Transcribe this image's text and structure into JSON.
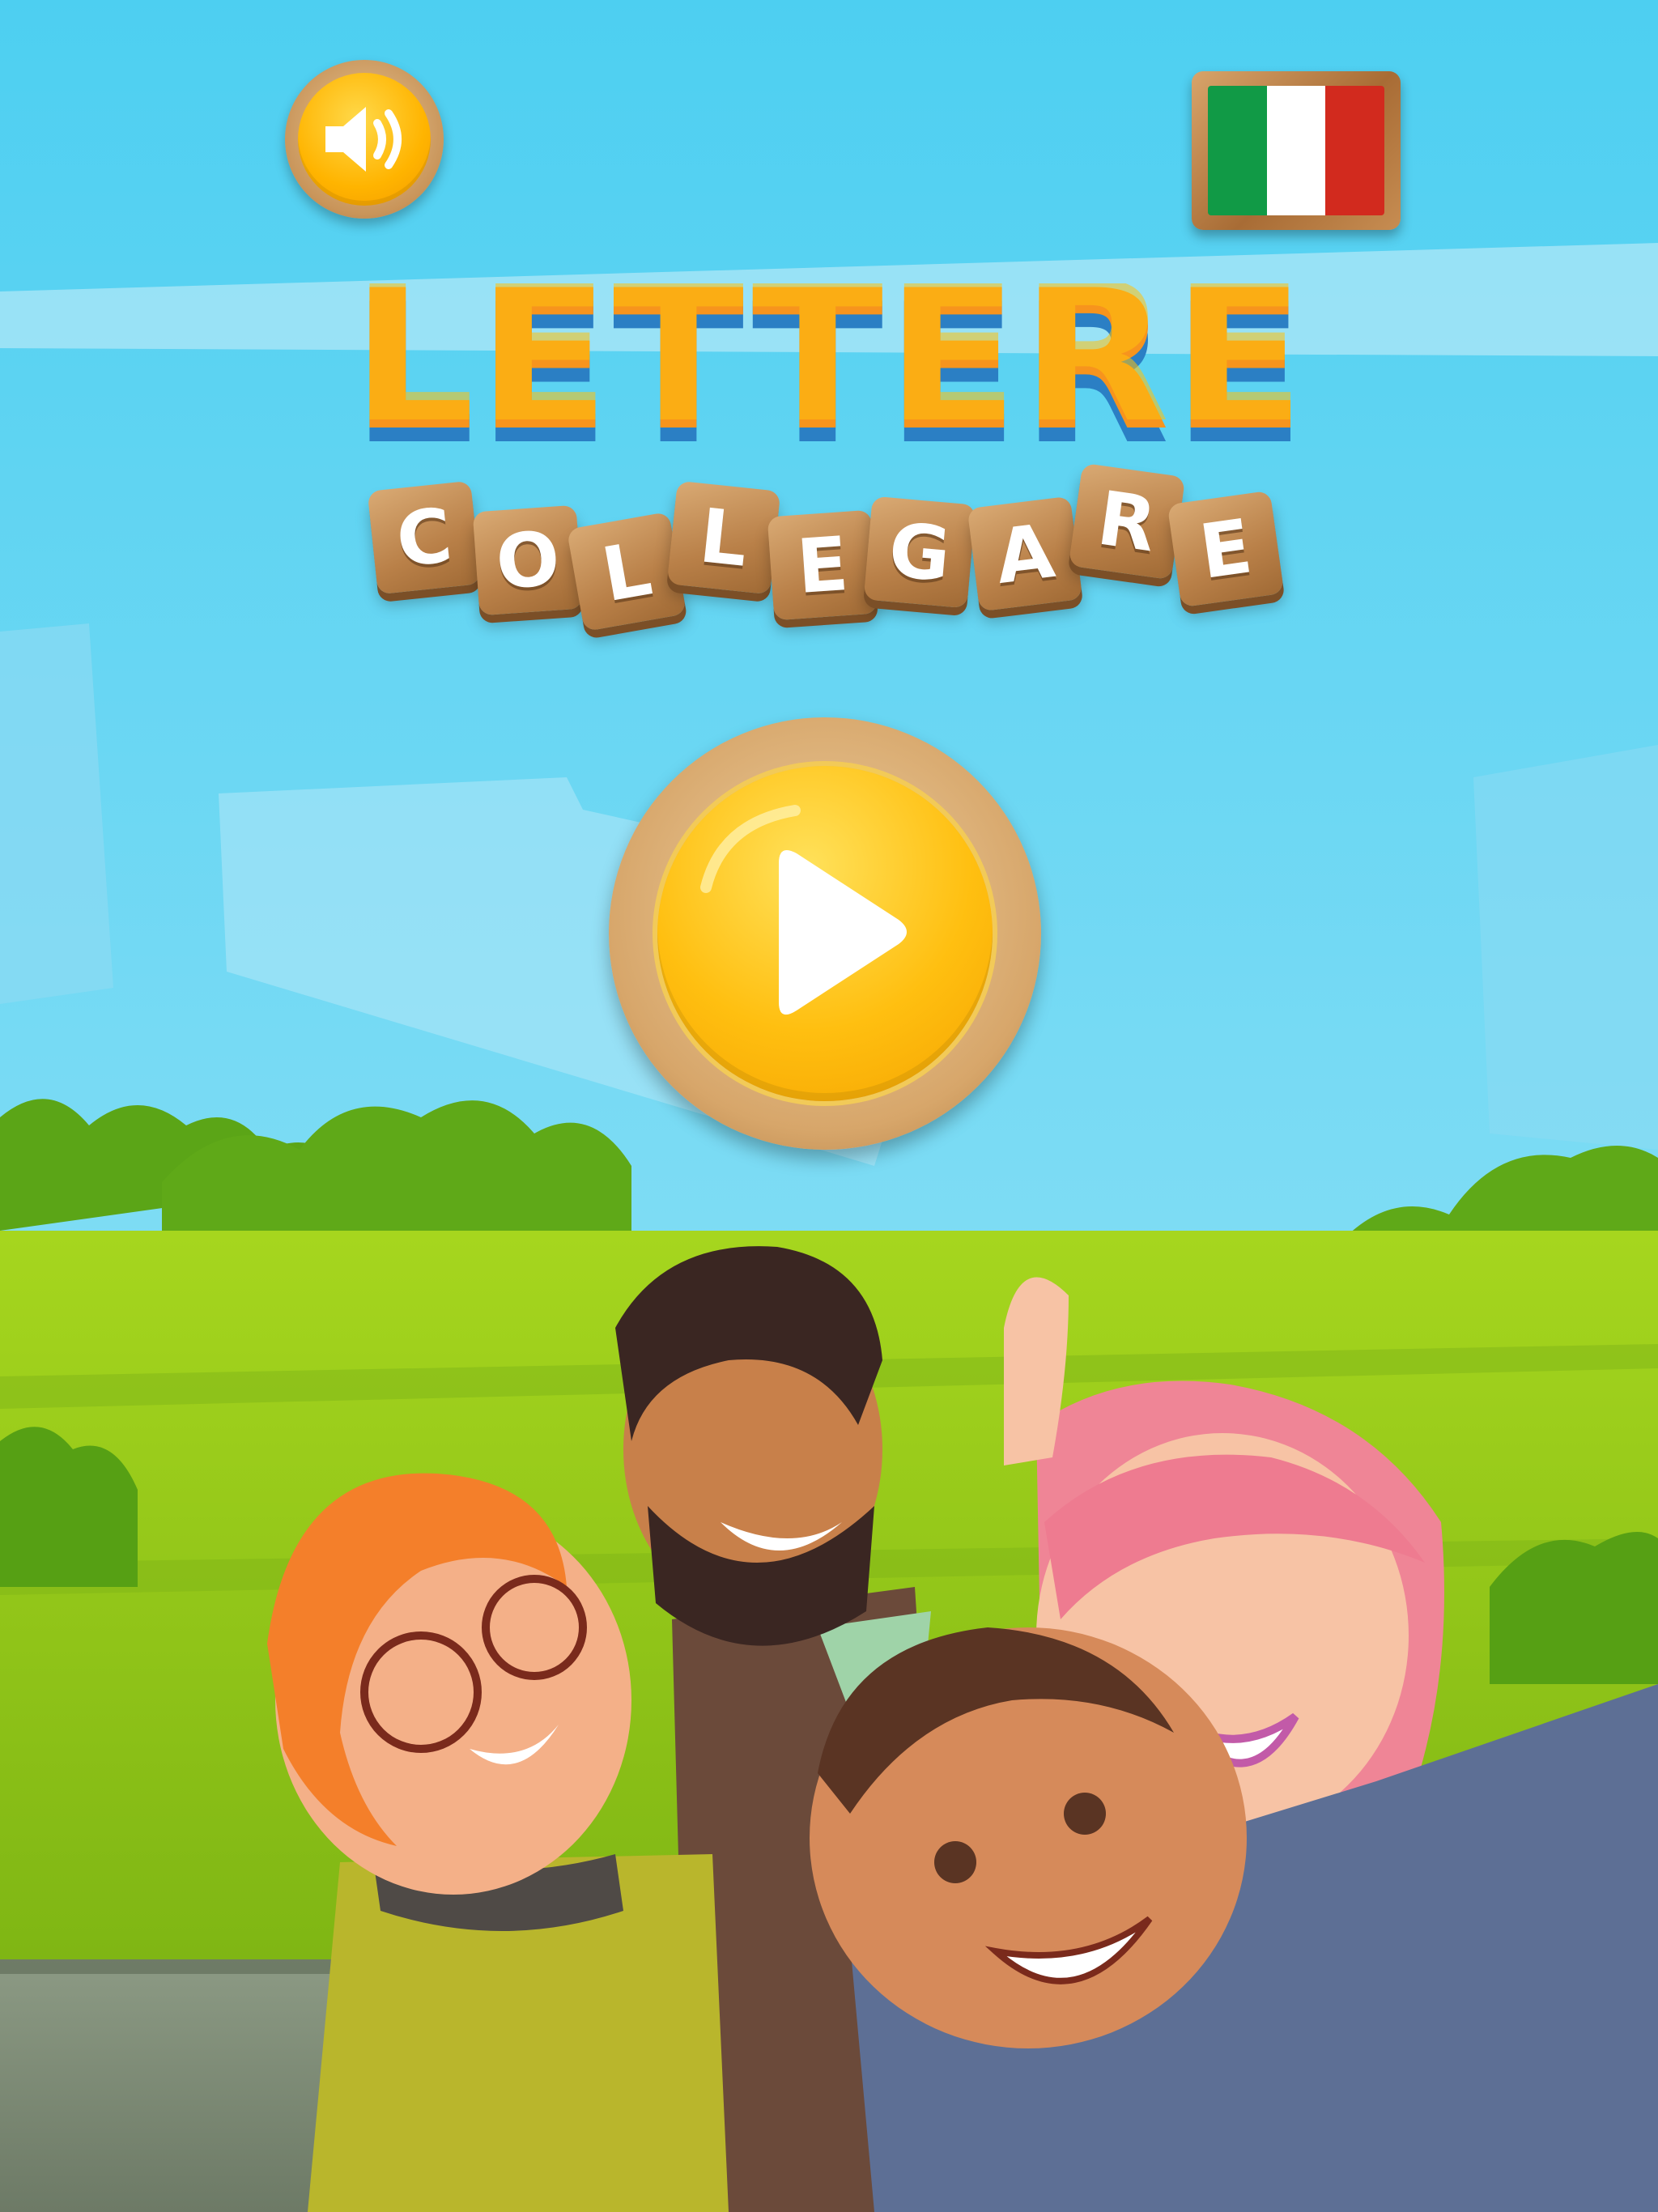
{
  "title": {
    "word1": "LETTERE",
    "word2_tiles": [
      "C",
      "O",
      "L",
      "L",
      "E",
      "G",
      "A",
      "R",
      "E"
    ]
  },
  "controls": {
    "sound_icon": "speaker-volume-icon",
    "language_flag": "italy-flag-icon",
    "play_icon": "play-triangle-icon"
  },
  "colors": {
    "sky_top": "#4fd0f0",
    "sky_bottom": "#9be3f6",
    "grass": "#8fc81a",
    "bush": "#5ba517",
    "button_yellow": "#ffbf10",
    "title_orange": "#f7941d",
    "title_yellow": "#ffc20e",
    "title_blue": "#2b7fc4",
    "flag_green": "#119a46",
    "flag_white": "#ffffff",
    "flag_red": "#d22a1e"
  }
}
